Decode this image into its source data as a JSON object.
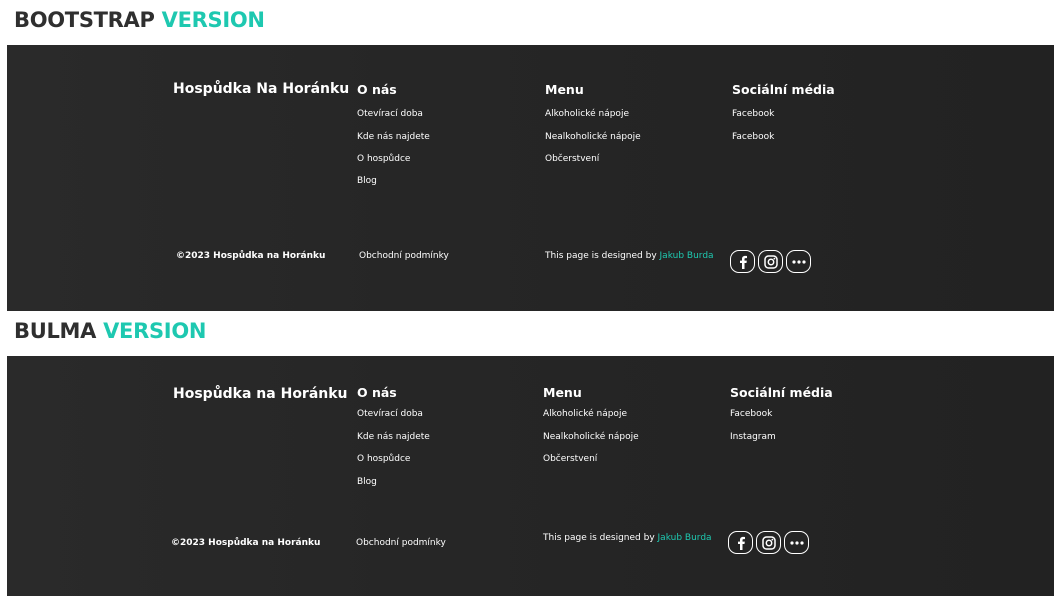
{
  "sections": {
    "bootstrap": {
      "heading_main": "BOOTSTRAP",
      "heading_accent": "VERSION",
      "brand": "Hospůdka Na Horánku",
      "col_about_title": "O nás",
      "col_about_links": [
        "Otevírací doba",
        "Kde nás najdete",
        "O hospůdce",
        "Blog"
      ],
      "col_menu_title": "Menu",
      "col_menu_links": [
        "Alkoholické nápoje",
        "Nealkoholické nápoje",
        "Občerstvení"
      ],
      "col_social_title": "Sociální média",
      "col_social_links": [
        "Facebook",
        "Facebook"
      ],
      "copyright": "©2023 Hospůdka na Horánku",
      "terms": "Obchodní podmínky",
      "designed_by": "This page is designed by",
      "author": "Jakub Burda"
    },
    "bulma": {
      "heading_main": "BULMA",
      "heading_accent": "VERSION",
      "brand": "Hospůdka na Horánku",
      "col_about_title": "O nás",
      "col_about_links": [
        "Otevírací doba",
        "Kde nás najdete",
        "O hospůdce",
        "Blog"
      ],
      "col_menu_title": "Menu",
      "col_menu_links": [
        "Alkoholické nápoje",
        "Nealkoholické nápoje",
        "Občerstvení"
      ],
      "col_social_title": "Sociální média",
      "col_social_links": [
        "Facebook",
        "Instagram"
      ],
      "copyright": "©2023 Hospůdka na Horánku",
      "terms": "Obchodní podmínky",
      "designed_by": "This page is designed by",
      "author": "Jakub Burda"
    }
  },
  "icons": [
    "facebook-icon",
    "instagram-icon",
    "more-icon"
  ],
  "colors": {
    "accent": "#1ec8b0",
    "footer_background": "#262626",
    "heading_text": "#2f2f2f"
  }
}
